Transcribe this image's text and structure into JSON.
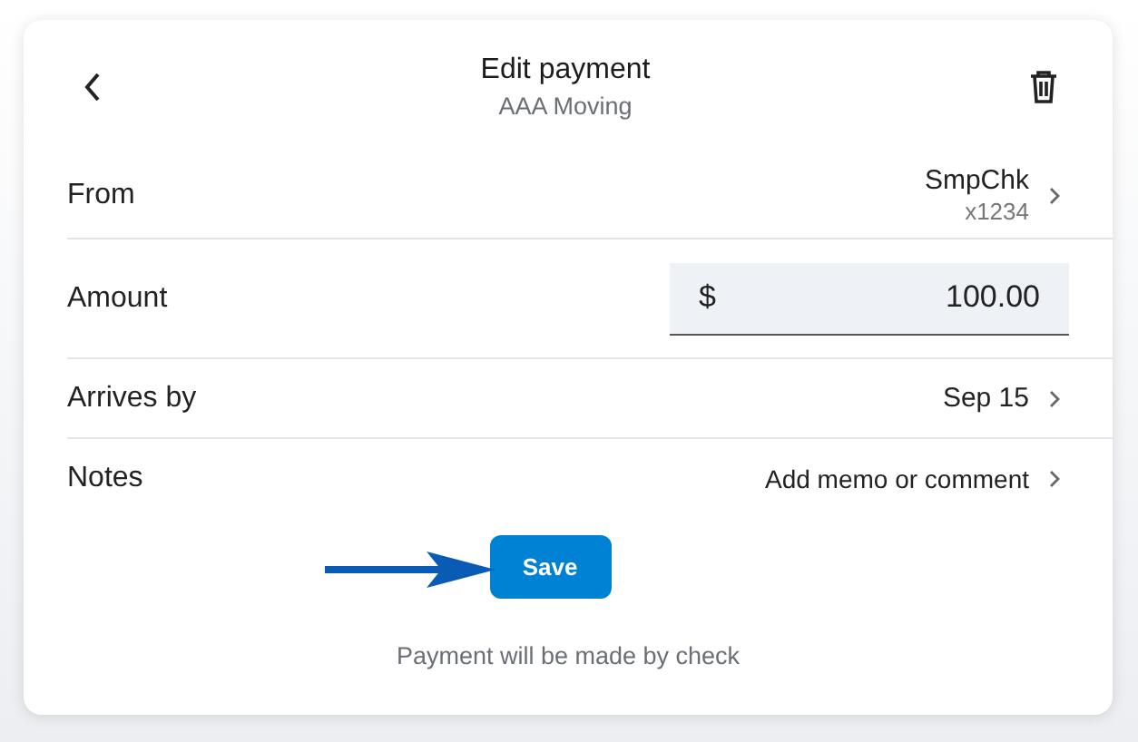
{
  "header": {
    "title": "Edit payment",
    "subtitle": "AAA Moving"
  },
  "rows": [
    {
      "kind": "account",
      "label": "From",
      "value": "SmpChk",
      "detail": "x1234"
    },
    {
      "kind": "amount",
      "label": "Amount",
      "currency": "$",
      "value": "100.00"
    },
    {
      "kind": "link",
      "label": "Arrives by",
      "value": "Sep 15"
    },
    {
      "kind": "link",
      "label": "Notes",
      "value": "Add memo or comment"
    }
  ],
  "save_button": {
    "label": "Save"
  },
  "footnote": "Payment will be made by check"
}
